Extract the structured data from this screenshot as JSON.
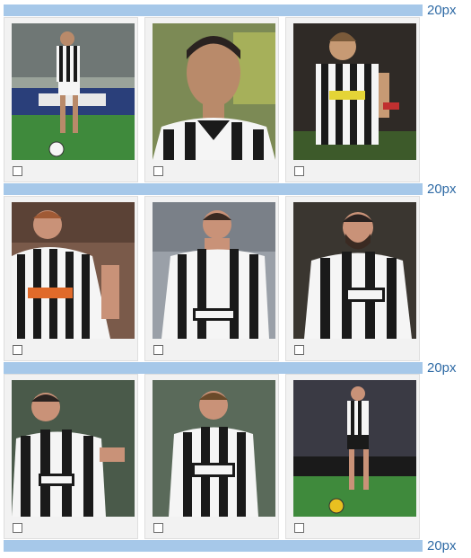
{
  "gallery": {
    "spacer_label": "20px",
    "rows": [
      {
        "photos": [
          {
            "icon": "player-photo-icon",
            "checked": false
          },
          {
            "icon": "player-photo-icon",
            "checked": false
          },
          {
            "icon": "player-photo-icon",
            "checked": false
          }
        ]
      },
      {
        "photos": [
          {
            "icon": "player-photo-icon",
            "checked": false
          },
          {
            "icon": "player-photo-icon",
            "checked": false
          },
          {
            "icon": "player-photo-icon",
            "checked": false
          }
        ]
      },
      {
        "photos": [
          {
            "icon": "player-photo-icon",
            "checked": false
          },
          {
            "icon": "player-photo-icon",
            "checked": false
          },
          {
            "icon": "player-photo-icon",
            "checked": false
          }
        ]
      }
    ]
  },
  "colors": {
    "spacer": "#a6c8e9",
    "spacer_text": "#2e6aa5",
    "card_bg": "#f2f2f2",
    "jersey_black": "#1a1a1a",
    "jersey_white": "#f5f5f5"
  }
}
